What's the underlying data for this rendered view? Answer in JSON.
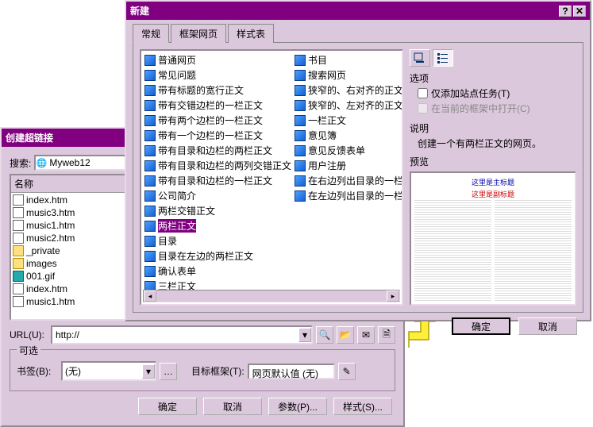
{
  "hyperlink": {
    "title": "创建超链接",
    "search_label": "搜索:",
    "search_value": "Myweb12",
    "filelist_header": "名称",
    "files": [
      {
        "icon": "doc",
        "name": "index.htm"
      },
      {
        "icon": "doc",
        "name": "music3.htm"
      },
      {
        "icon": "doc",
        "name": "music1.htm"
      },
      {
        "icon": "doc",
        "name": "music2.htm"
      },
      {
        "icon": "folder",
        "name": "_private"
      },
      {
        "icon": "folder",
        "name": "images"
      },
      {
        "icon": "gif",
        "name": "001.gif"
      },
      {
        "icon": "doc",
        "name": "index.htm"
      },
      {
        "icon": "doc",
        "name": "music1.htm"
      }
    ],
    "url_label": "URL(U):",
    "url_value": "http://",
    "optional_legend": "可选",
    "bookmark_label": "书签(B):",
    "bookmark_value": "(无)",
    "frame_label": "目标框架(T):",
    "frame_value": "网页默认值 (无)",
    "ok": "确定",
    "cancel": "取消",
    "params": "参数(P)...",
    "style": "样式(S)..."
  },
  "newdlg": {
    "title": "新建",
    "tabs": [
      "常规",
      "框架网页",
      "样式表"
    ],
    "templates_col1": [
      "普通网页",
      "常见问题",
      "带有标题的宽行正文",
      "带有交错边栏的一栏正文",
      "带有两个边栏的一栏正文",
      "带有一个边栏的一栏正文",
      "带有目录和边栏的两栏正文",
      "带有目录和边栏的两列交错正文",
      "带有目录和边栏的一栏正文",
      "公司简介",
      "两栏交错正文",
      "两栏正文",
      "目录",
      "目录在左边的两栏正文",
      "确认表单",
      "三栏正文"
    ],
    "templates_col2": [
      "书目",
      "搜索网页",
      "狭窄的、右对齐的正文",
      "狭窄的、左对齐的正文",
      "一栏正文",
      "意见簿",
      "意见反馈表单",
      "用户注册",
      "在右边列出目录的一栏",
      "在左边列出目录的一栏"
    ],
    "selected_template": "两栏正文",
    "options_label": "选项",
    "opt_task": "仅添加站点任务(T)",
    "opt_frame": "在当前的框架中打开(C)",
    "desc_label": "说明",
    "desc_text": "创建一个有两栏正文的网页。",
    "preview_label": "预览",
    "preview_title": "这里是主标题",
    "preview_sub": "这里是副标题",
    "ok": "确定",
    "cancel": "取消"
  }
}
